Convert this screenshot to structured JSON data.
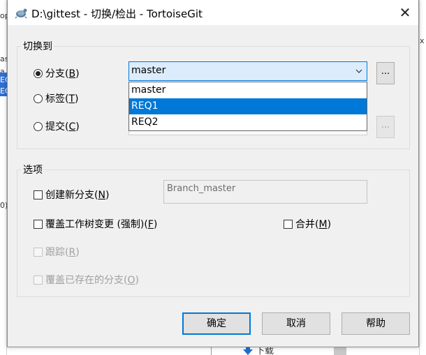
{
  "window": {
    "title": "D:\\gittest - 切换/检出 - TortoiseGit",
    "close_glyph": "✕"
  },
  "switch_to": {
    "legend": "切换到",
    "branch": {
      "label": "分支(",
      "key": "B",
      "suffix": ")",
      "checked": true
    },
    "tag": {
      "label": "标签(",
      "key": "T",
      "suffix": ")",
      "checked": false
    },
    "commit": {
      "label": "提交(",
      "key": "C",
      "suffix": ")",
      "checked": false
    },
    "branch_combo": {
      "value": "master"
    },
    "dropdown_options": [
      "master",
      "REQ1",
      "REQ2"
    ],
    "selected_option": "REQ1",
    "browse_label": "..."
  },
  "options": {
    "legend": "选项",
    "create_branch": {
      "label": "创建新分支(",
      "key": "N",
      "suffix": ")",
      "checked": false
    },
    "new_branch_name": "Branch_master",
    "override_worktree": {
      "label": "覆盖工作树变更 (强制)(",
      "key": "F",
      "suffix": ")",
      "checked": false
    },
    "merge": {
      "label": "合并(",
      "key": "M",
      "suffix": ")",
      "checked": false
    },
    "track": {
      "label": "跟踪(",
      "key": "R",
      "suffix": ")",
      "checked": false,
      "disabled": true
    },
    "override_existing": {
      "label": "覆盖已存在的分支(",
      "key": "O",
      "suffix": ")",
      "checked": false,
      "disabled": true
    }
  },
  "buttons": {
    "ok": "确定",
    "cancel": "取消",
    "help": "帮助"
  },
  "background": {
    "left_fragments": [
      "op",
      "as",
      "a",
      "EQ",
      "EQ",
      "0)"
    ],
    "right_fragment": "x",
    "bottom_text": "下载"
  },
  "colors": {
    "accent": "#0078d7",
    "selection_fill": "#dcecfc"
  },
  "icons": {
    "title": "tortoisegit-icon",
    "close": "close-icon",
    "chevron": "chevron-down-icon",
    "download": "download-arrow-icon"
  }
}
